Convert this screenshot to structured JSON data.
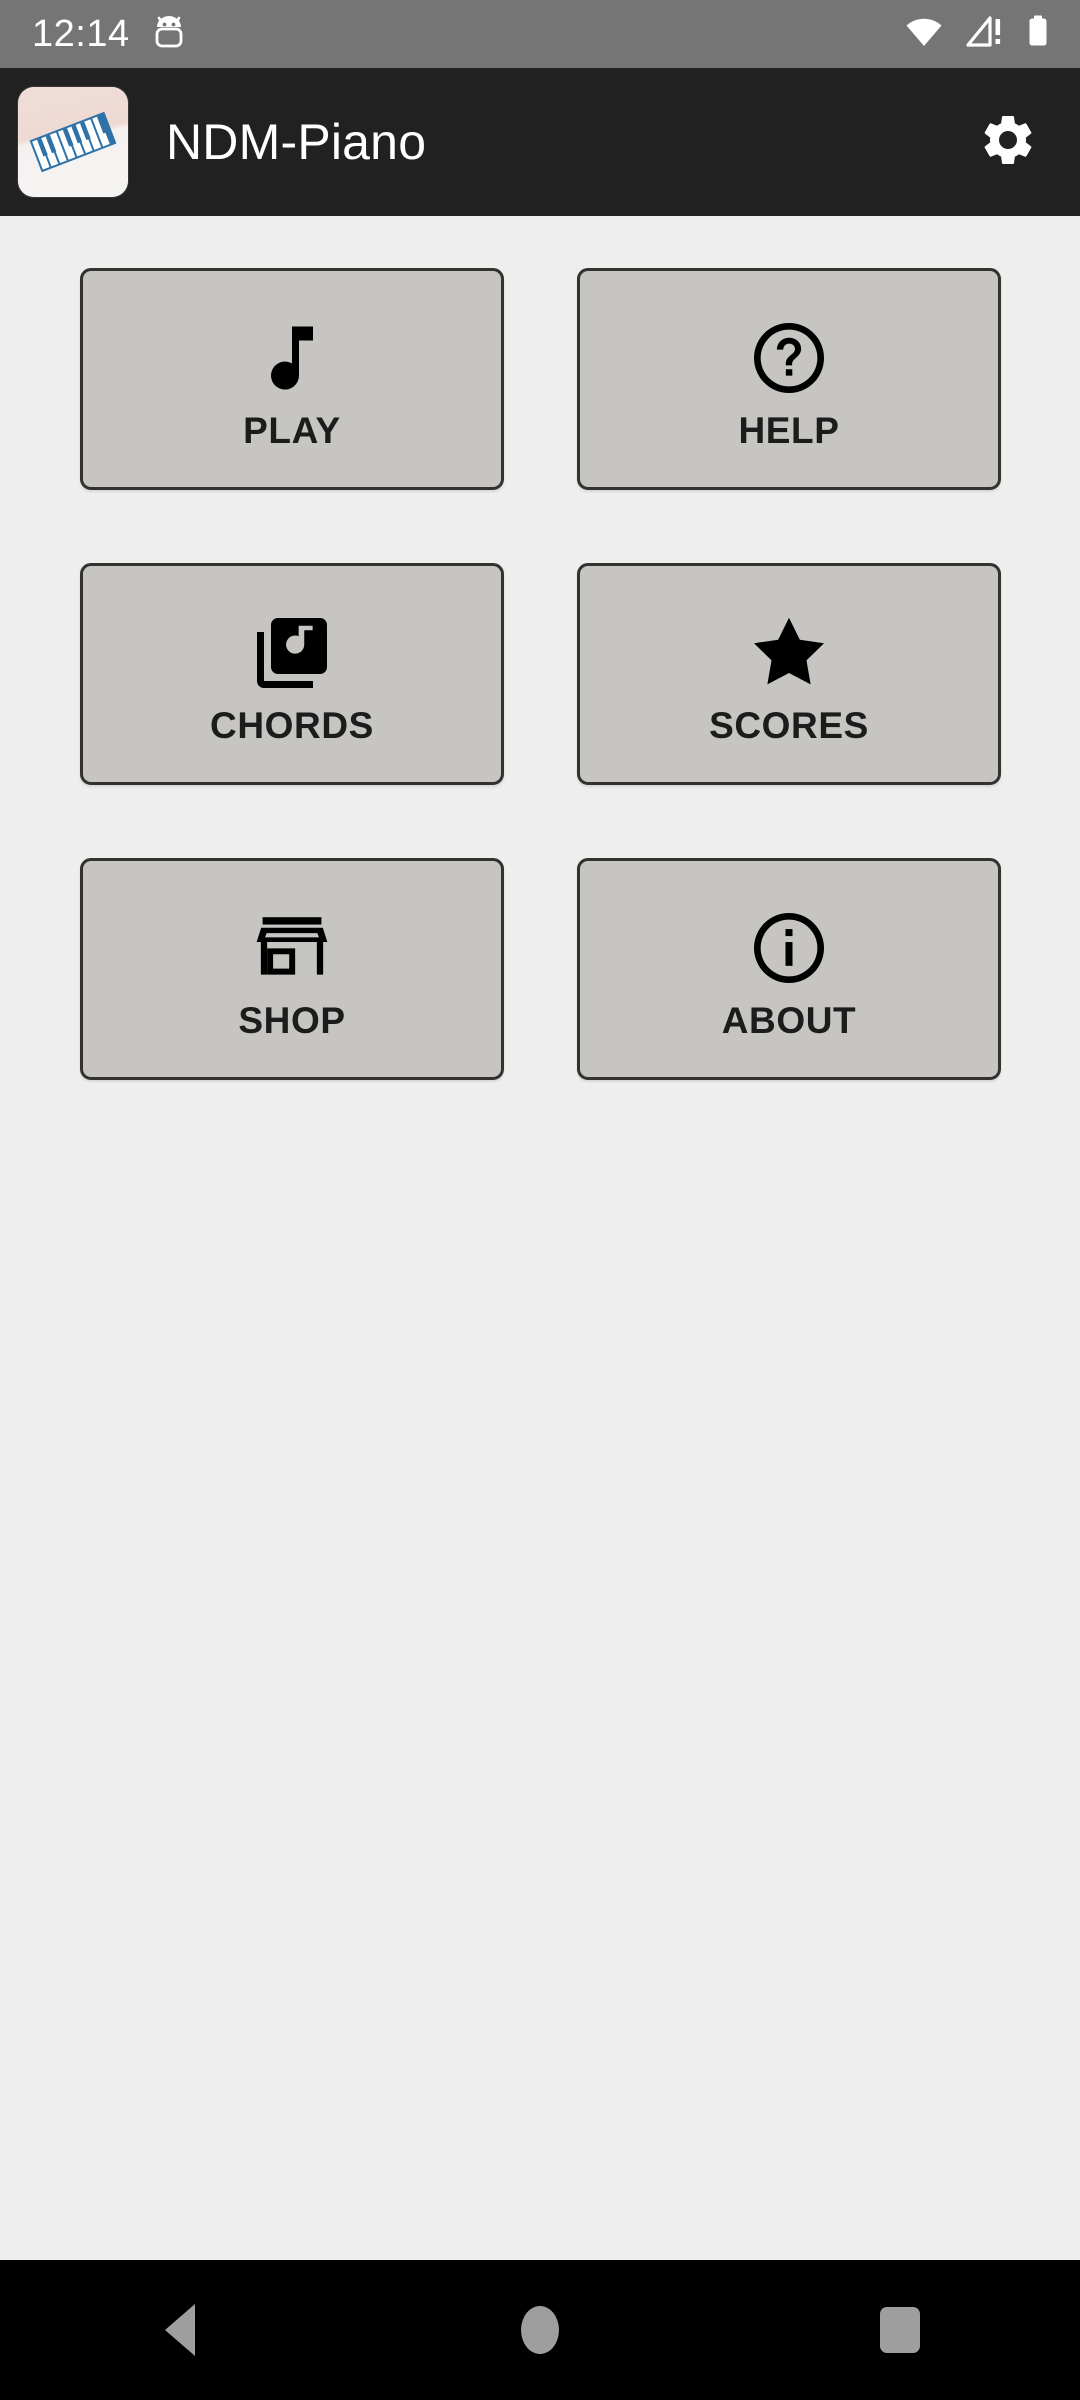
{
  "status_bar": {
    "time": "12:14",
    "icons": [
      {
        "name": "android-head-icon"
      },
      {
        "name": "wifi-icon"
      },
      {
        "name": "cellular-no-service-icon"
      },
      {
        "name": "battery-full-icon"
      }
    ],
    "background_color": "#757575",
    "foreground_color": "#ffffff"
  },
  "app_bar": {
    "title": "NDM-Piano",
    "app_icon_name": "piano-keyboard-app-icon",
    "settings_icon_name": "gear-icon",
    "background_color": "#212121",
    "title_color": "#ffffff"
  },
  "main": {
    "background_color": "#efeeee",
    "tile_fill_color": "#c6c5c2",
    "tile_border_color": "#33322f",
    "tile_label_color": "#1c1c1c",
    "tiles": [
      {
        "label": "PLAY",
        "icon": "music-note-icon"
      },
      {
        "label": "HELP",
        "icon": "help-circle-icon"
      },
      {
        "label": "CHORDS",
        "icon": "library-music-icon"
      },
      {
        "label": "SCORES",
        "icon": "star-icon"
      },
      {
        "label": "SHOP",
        "icon": "storefront-icon"
      },
      {
        "label": "ABOUT",
        "icon": "info-circle-icon"
      }
    ]
  },
  "nav_bar": {
    "background_color": "#000000",
    "icon_color": "#9e9e9e",
    "buttons": [
      {
        "name": "back-button",
        "icon": "triangle-left-icon"
      },
      {
        "name": "home-button",
        "icon": "circle-icon"
      },
      {
        "name": "recents-button",
        "icon": "square-icon"
      }
    ]
  }
}
